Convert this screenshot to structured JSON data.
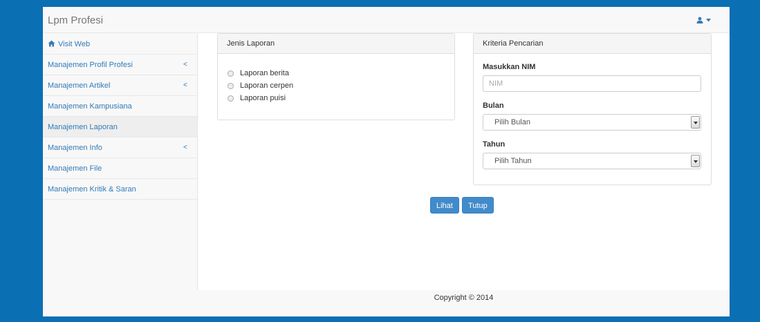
{
  "navbar": {
    "brand": "Lpm Profesi",
    "user_icon": "user-icon",
    "dropdown_icon": "caret-down-icon"
  },
  "sidebar": {
    "items": [
      {
        "label": "Visit Web",
        "icon": "home-icon",
        "has_submenu": false,
        "active": false
      },
      {
        "label": "Manajemen Profil Profesi",
        "has_submenu": true,
        "active": false
      },
      {
        "label": "Manajemen Artikel",
        "has_submenu": true,
        "active": false
      },
      {
        "label": "Manajemen Kampusiana",
        "has_submenu": false,
        "active": false
      },
      {
        "label": "Manajemen Laporan",
        "has_submenu": false,
        "active": true
      },
      {
        "label": "Manajemen Info",
        "has_submenu": true,
        "active": false
      },
      {
        "label": "Manajemen File",
        "has_submenu": false,
        "active": false
      },
      {
        "label": "Manajemen Kritik & Saran",
        "has_submenu": false,
        "active": false
      }
    ],
    "submenu_glyph": "<"
  },
  "jenis_laporan": {
    "title": "Jenis Laporan",
    "options": [
      "Laporan berita",
      "Laporan cerpen",
      "Laporan puisi"
    ]
  },
  "kriteria": {
    "title": "Kriteria Pencarian",
    "nim_label": "Masukkan NIM",
    "nim_placeholder": "NIM",
    "nim_value": "",
    "bulan_label": "Bulan",
    "bulan_selected": "Pilih Bulan",
    "tahun_label": "Tahun",
    "tahun_selected": "Pilih Tahun"
  },
  "actions": {
    "lihat": "Lihat",
    "tutup": "Tutup"
  },
  "footer": {
    "copyright": "Copyright © 2014"
  },
  "colors": {
    "background": "#0a6fb3",
    "link": "#337ab7",
    "button": "#428bca"
  }
}
